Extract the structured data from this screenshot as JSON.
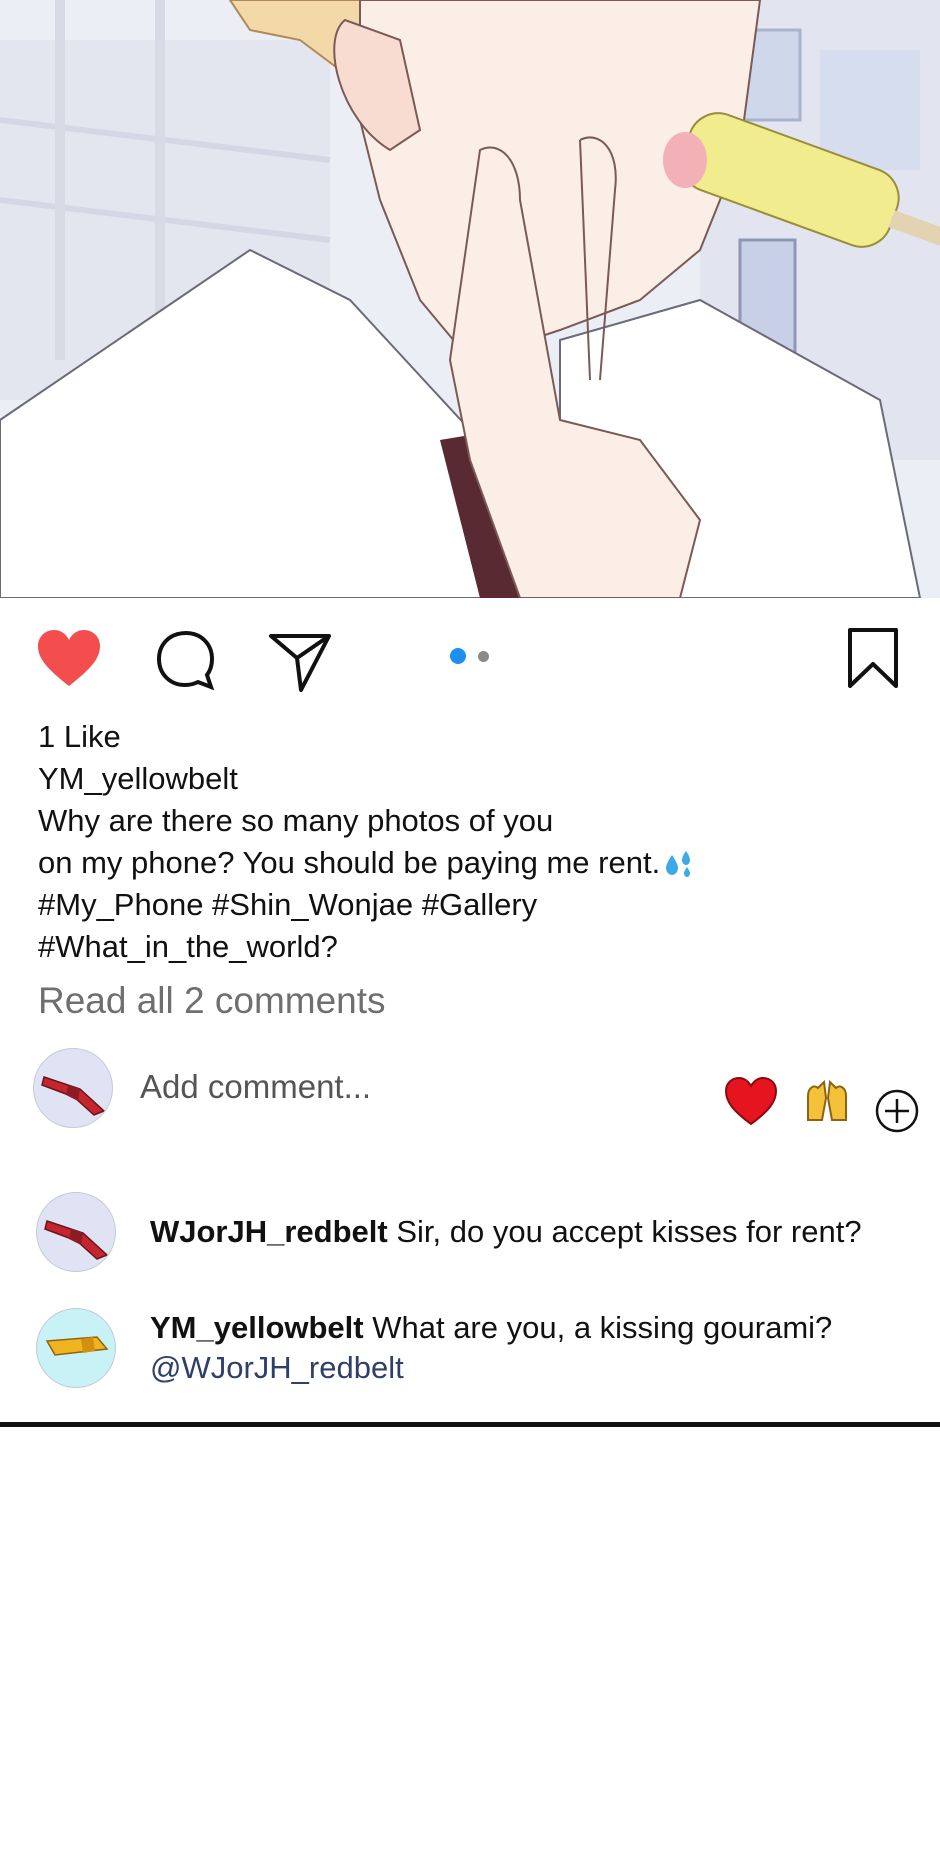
{
  "post": {
    "likes": "1 Like",
    "username": "YM_yellowbelt",
    "caption_lines": [
      "Why are there so many photos of you",
      "on my phone? You should be paying me rent.",
      "#My_Phone #Shin_Wonjae #Gallery",
      "#What_in_the_world?"
    ],
    "read_all": "Read all 2 comments"
  },
  "icons": {
    "like": "heart-icon",
    "comment": "comment-bubble-icon",
    "share": "paper-plane-icon",
    "save": "bookmark-icon",
    "droplets": "sweat-droplets-emoji",
    "quick_heart": "red-heart-emoji",
    "quick_hands": "raised-hands-emoji",
    "add_reaction": "plus-circle-icon"
  },
  "carousel": {
    "count": 2,
    "active_index": 0
  },
  "add_comment": {
    "placeholder": "Add comment..."
  },
  "comments": [
    {
      "user": "WJorJH_redbelt",
      "text": " Sir, do you accept kisses for rent?",
      "mention": ""
    },
    {
      "user": "YM_yellowbelt",
      "text": " What are you, a kissing gourami?",
      "mention": "@WJorJH_redbelt"
    }
  ],
  "colors": {
    "like_red": "#f44d4d",
    "active_dot": "#1e8ff0",
    "inactive_dot": "#8a8a8a",
    "mention": "#2f3f67",
    "avatar_red_bg": "#dfe3f4",
    "avatar_yellow_bg": "#c8f2f6"
  }
}
